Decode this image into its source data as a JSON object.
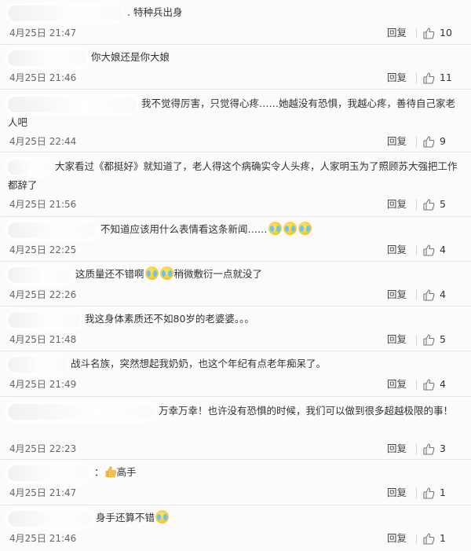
{
  "reply_label": "回复",
  "comments": [
    {
      "text": ". 特种兵出身",
      "time": "4月25日 21:47",
      "likes": "10"
    },
    {
      "text": "你大娘还是你大娘",
      "time": "4月25日 21:46",
      "likes": "11"
    },
    {
      "text": "我不觉得厉害，只觉得心疼……她越没有恐惧，我越心疼，善待自己家老人吧",
      "time": "4月25日 22:44",
      "likes": "9"
    },
    {
      "text": "大家看过《都挺好》就知道了，老人得这个病确实令人头疼，人家明玉为了照顾苏大强把工作都辞了",
      "time": "4月25日 21:56",
      "likes": "5"
    },
    {
      "text": "不知道应该用什么表情看这条新闻……",
      "time": "4月25日 22:25",
      "likes": "4"
    },
    {
      "text_a": "这质量还不错啊",
      "text_b": "稍微敷衍一点就没了",
      "time": "4月25日 22:26",
      "likes": "4"
    },
    {
      "text": "我这身体素质还不如80岁的老婆婆。。。",
      "time": "4月25日 21:48",
      "likes": "5"
    },
    {
      "text": "战斗名族，突然想起我奶奶，也这个年纪有点老年痴呆了。",
      "time": "4月25日 21:49",
      "likes": "4"
    },
    {
      "text": "万幸万幸！也许没有恐惧的时候，我们可以做到很多超越极限的事！",
      "time": "4月25日 22:23",
      "likes": "3"
    },
    {
      "text_a": "：",
      "text_b": "高手",
      "time": "4月25日 21:47",
      "likes": "1"
    },
    {
      "text": "身手还算不错",
      "time": "4月25日 21:46",
      "likes": "1"
    }
  ],
  "icons": {
    "like": "thumbs-up-icon",
    "emoji": "laugh-cry-emoji-icon",
    "thumb": "thumbs-up-emoji-icon"
  },
  "colors": {
    "background": "#fbfbfb",
    "divider": "#e6e6e6",
    "meta_text": "#666666"
  }
}
